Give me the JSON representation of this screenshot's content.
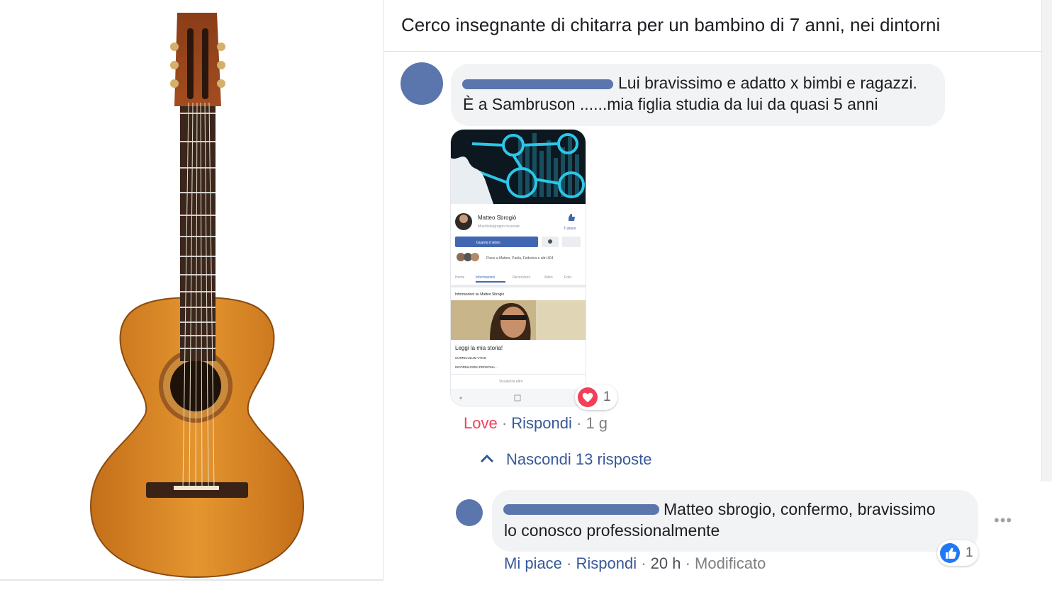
{
  "post": {
    "title": "Cerco insegnante di chitarra per un bambino di 7 anni, nei dintorni"
  },
  "comment1": {
    "line1": "Lui bravissimo e adatto x bimbi e ragazzi.",
    "line2": "È a Sambruson ......mia figlia studia da lui da quasi 5 anni",
    "reaction_count": "1",
    "actions": {
      "love": "Love",
      "reply": "Rispondi",
      "time": "1 g"
    },
    "replies_toggle": "Nascondi 13 risposte"
  },
  "screenshot": {
    "page_name": "Matteo Sbrogiò",
    "page_category": "Musicista/gruppo musicale",
    "like_label": "Ti piace",
    "watch_button": "Guarda il video",
    "likes_text": "Piace a Matteo, Paola, Federica e altri 404",
    "tabs": [
      "Home",
      "Informazioni",
      "Recensioni",
      "Video",
      "Foto"
    ],
    "about_title": "Informazioni su Matteo Sbrogiò",
    "story_title": "Leggi la mia storia!",
    "story_line1": "CURRICULUM VITAE",
    "story_line2": "INFORMAZIONI PERSONA...",
    "see_more": "Visualizza altro"
  },
  "comment2": {
    "line1": "Matteo sbrogio, confermo, bravissimo",
    "line2": "lo conosco professionalmente",
    "reaction_count": "1",
    "actions": {
      "like": "Mi piace",
      "reply": "Rispondi",
      "time": "20 h",
      "edited": "Modificato"
    }
  },
  "colors": {
    "link": "#385898",
    "love": "#f33e58",
    "like_blue": "#2078f4",
    "bubble": "#f2f3f5",
    "redaction": "#5a76ad",
    "guitar_wood": "#d98a2a"
  },
  "icons": [
    "guitar-photo",
    "heart-icon",
    "thumbs-up-icon",
    "chevron-up-icon",
    "more-icon"
  ]
}
